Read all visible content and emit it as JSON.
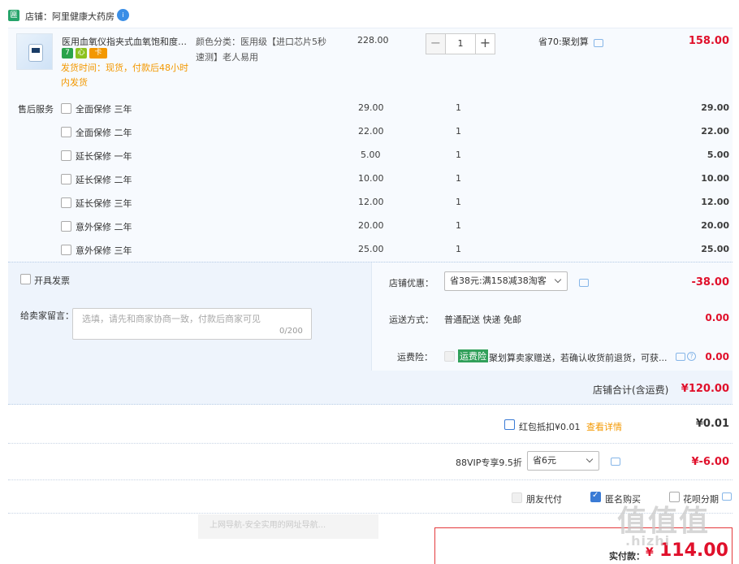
{
  "shop": {
    "icon_label": "匾",
    "name": "店铺：阿里健康大药房",
    "badge": "i"
  },
  "item": {
    "title": "医用血氧仪指夹式血氧饱和度检...",
    "tags": [
      {
        "label": "7",
        "color": "#2aa34a"
      },
      {
        "label": "心",
        "color": "#8dc21f"
      },
      {
        "label": "卡",
        "color": "#f39800"
      }
    ],
    "ship_time": "发货时间：现货，付款后48小时内发货",
    "sku": "颜色分类：医用级【进口芯片5秒速测】老人易用",
    "unit_price": "228.00",
    "qty": "1",
    "minus": "−",
    "plus": "+",
    "promo": "省70:聚划算",
    "total": "158.00"
  },
  "after_sales": {
    "label": "售后服务",
    "services": [
      {
        "name": "全面保修 三年",
        "price": "29.00",
        "qty": "1",
        "total": "29.00"
      },
      {
        "name": "全面保修 二年",
        "price": "22.00",
        "qty": "1",
        "total": "22.00"
      },
      {
        "name": "延长保修 一年",
        "price": "5.00",
        "qty": "1",
        "total": "5.00"
      },
      {
        "name": "延长保修 二年",
        "price": "10.00",
        "qty": "1",
        "total": "10.00"
      },
      {
        "name": "延长保修 三年",
        "price": "12.00",
        "qty": "1",
        "total": "12.00"
      },
      {
        "name": "意外保修 二年",
        "price": "20.00",
        "qty": "1",
        "total": "20.00"
      },
      {
        "name": "意外保修 三年",
        "price": "25.00",
        "qty": "1",
        "total": "25.00"
      }
    ]
  },
  "options": {
    "invoice_label": "开具发票",
    "remark_label": "给卖家留言：",
    "remark_placeholder": "选填，请先和商家协商一致，付款后商家可见",
    "remark_count": "0/200",
    "shop_discount_label": "店铺优惠：",
    "shop_discount_value": "省38元:满158减38淘客",
    "shop_discount_amount": "-38.00",
    "shipping_label": "运送方式：",
    "shipping_value": "普通配送 快递 免邮",
    "shipping_amount": "0.00",
    "insurance_label": "运费险：",
    "insurance_tag": "运费险",
    "insurance_text": "聚划算卖家赠送，若确认收货前退货，可获...",
    "insurance_amount": "0.00",
    "shop_total_label": "店铺合计(含运费)",
    "shop_total_value": "¥120.00"
  },
  "bottom": {
    "redpack_label": "红包抵扣¥0.01",
    "redpack_link": "查看详情",
    "redpack_amount": "¥0.01",
    "vip_label": "88VIP专享9.5折",
    "vip_select": "省6元",
    "vip_amount": "¥-6.00",
    "friend_pay": "朋友代付",
    "anonymous": "匿名购买",
    "huabei": "花呗分期",
    "pay_label": "实付款：",
    "pay_currency": "¥",
    "pay_amount": "114.00",
    "overlay_text": "上网导航-安全实用的网址导航...",
    "watermark": "值值值",
    "watermark_url": ".hizhi"
  }
}
